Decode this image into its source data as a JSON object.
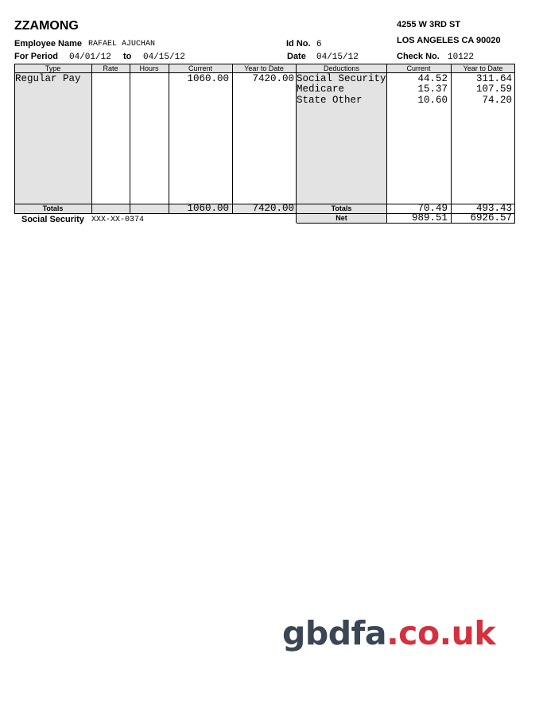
{
  "company": "ZZAMONG",
  "address": {
    "line1": "4255 W 3RD ST",
    "line2": "LOS ANGELES CA 90020"
  },
  "employee": {
    "name_label": "Employee Name",
    "name": "RAFAEL AJUCHAN",
    "id_label": "Id No.",
    "id": "6"
  },
  "period": {
    "label": "For Period",
    "start": "04/01/12",
    "to_label": "to",
    "end": "04/15/12"
  },
  "date": {
    "label": "Date",
    "value": "04/15/12"
  },
  "check": {
    "label": "Check No.",
    "value": "10122"
  },
  "earnings_headers": [
    "Type",
    "Rate",
    "Hours",
    "Current",
    "Year to Date"
  ],
  "deductions_headers": [
    "Deductions",
    "Current",
    "Year to Date"
  ],
  "earnings": [
    {
      "type": "Regular Pay",
      "rate": "",
      "hours": "",
      "current": "1060.00",
      "ytd": "7420.00"
    }
  ],
  "deductions": [
    {
      "name": "Social Security",
      "current": "44.52",
      "ytd": "311.64"
    },
    {
      "name": "Medicare",
      "current": "15.37",
      "ytd": "107.59"
    },
    {
      "name": "State Other",
      "current": "10.60",
      "ytd": "74.20"
    }
  ],
  "earnings_totals": {
    "label": "Totals",
    "current": "1060.00",
    "ytd": "7420.00"
  },
  "deductions_totals": {
    "label": "Totals",
    "current": "70.49",
    "ytd": "493.43"
  },
  "net": {
    "label": "Net",
    "current": "989.51",
    "ytd": "6926.57"
  },
  "ssn": {
    "label": "Social Security",
    "value": "XXX-XX-0374"
  },
  "watermark": {
    "part1": "gbdfa",
    "part2": ".co.uk"
  }
}
